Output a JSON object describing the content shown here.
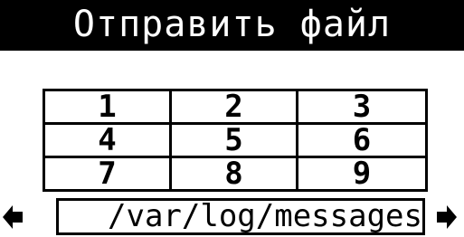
{
  "header": {
    "title": "Отправить файл"
  },
  "keypad": {
    "keys": [
      "1",
      "2",
      "3",
      "4",
      "5",
      "6",
      "7",
      "8",
      "9"
    ]
  },
  "file_selector": {
    "path": "/var/log/messages",
    "prev_icon": "left-arrow-icon",
    "next_icon": "right-arrow-icon"
  },
  "colors": {
    "background": "#ffffff",
    "foreground": "#000000"
  }
}
